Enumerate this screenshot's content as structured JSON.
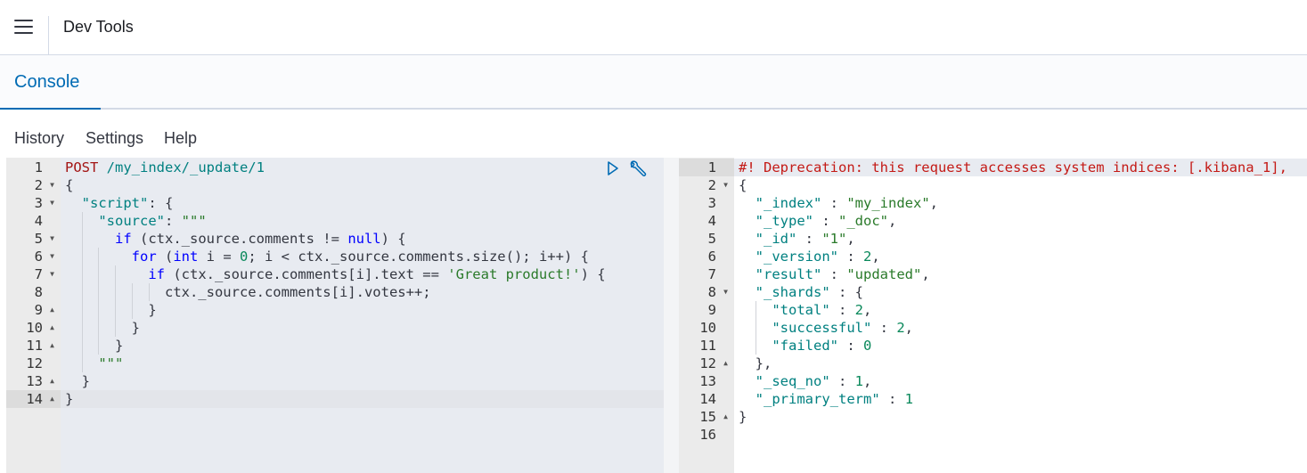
{
  "header": {
    "title": "Dev Tools"
  },
  "tabs": [
    {
      "label": "Console",
      "active": true
    }
  ],
  "menu": {
    "history": "History",
    "settings": "Settings",
    "help": "Help"
  },
  "request": {
    "lines": [
      "POST /my_index/_update/1",
      "{",
      "  \"script\": {",
      "    \"source\": \"\"\"",
      "      if (ctx._source.comments != null) {",
      "        for (int i = 0; i < ctx._source.comments.size(); i++) {",
      "          if (ctx._source.comments[i].text == 'Great product!') {",
      "            ctx._source.comments[i].votes++;",
      "          }",
      "        }",
      "      }",
      "    \"\"\"",
      "  }",
      "}"
    ],
    "line_numbers": [
      "1",
      "2",
      "3",
      "4",
      "5",
      "6",
      "7",
      "8",
      "9",
      "10",
      "11",
      "12",
      "13",
      "14"
    ],
    "folds": [
      "",
      "down",
      "down",
      "",
      "down",
      "down",
      "down",
      "",
      "up",
      "up",
      "up",
      "",
      "up",
      "up"
    ],
    "active_line": 14
  },
  "response": {
    "lines": [
      "#! Deprecation: this request accesses system indices: [.kibana_1],",
      "{",
      "  \"_index\" : \"my_index\",",
      "  \"_type\" : \"_doc\",",
      "  \"_id\" : \"1\",",
      "  \"_version\" : 2,",
      "  \"result\" : \"updated\",",
      "  \"_shards\" : {",
      "    \"total\" : 2,",
      "    \"successful\" : 2,",
      "    \"failed\" : 0",
      "  },",
      "  \"_seq_no\" : 1,",
      "  \"_primary_term\" : 1",
      "}",
      ""
    ],
    "line_numbers": [
      "1",
      "2",
      "3",
      "4",
      "5",
      "6",
      "7",
      "8",
      "9",
      "10",
      "11",
      "12",
      "13",
      "14",
      "15",
      "16"
    ],
    "folds": [
      "",
      "down",
      "",
      "",
      "",
      "",
      "",
      "down",
      "",
      "",
      "",
      "up",
      "",
      "",
      "up",
      ""
    ],
    "active_line": 1
  },
  "icons": {
    "run": "play-icon",
    "settings": "wrench-icon",
    "menu": "hamburger-icon"
  },
  "colors": {
    "accent": "#006bb4",
    "gutter": "#ebebeb",
    "editor_bg": "#e8ebf1"
  }
}
